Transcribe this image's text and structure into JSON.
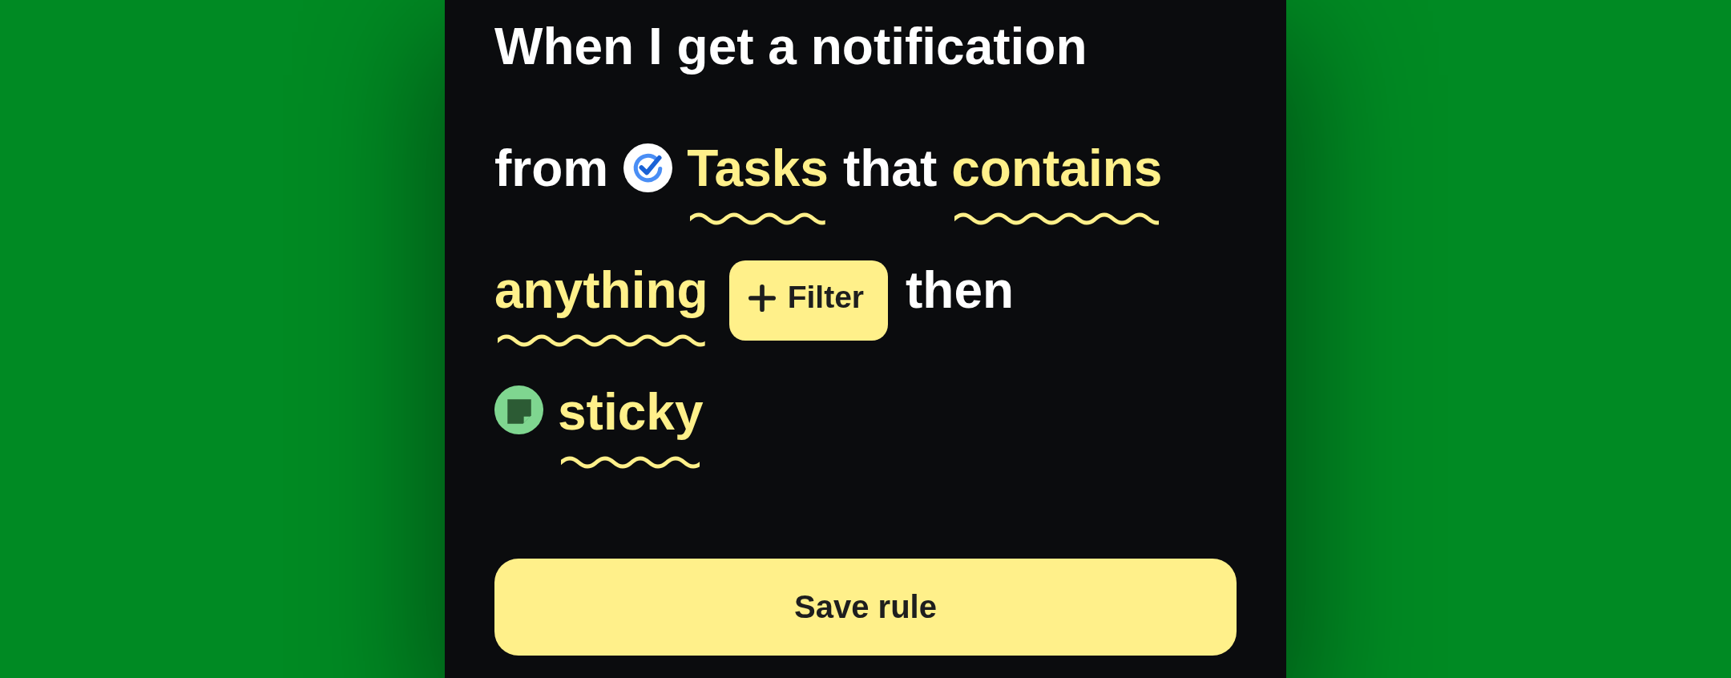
{
  "rule_sentence": {
    "lines": [
      [
        {
          "kind": "text",
          "text": "When I get a notification"
        }
      ],
      [
        {
          "kind": "text",
          "text": "from"
        },
        {
          "kind": "source_icon"
        },
        {
          "kind": "choice",
          "text": "Tasks"
        },
        {
          "kind": "text",
          "text": "that"
        },
        {
          "kind": "choice",
          "text": "contains"
        }
      ],
      [
        {
          "kind": "choice",
          "text": "anything"
        },
        {
          "kind": "button",
          "text": "Filter"
        },
        {
          "kind": "text",
          "text": "then"
        }
      ],
      [
        {
          "kind": "action_icon"
        },
        {
          "kind": "choice",
          "text": "sticky"
        }
      ]
    ]
  },
  "save_button": {
    "label": "Save rule"
  }
}
